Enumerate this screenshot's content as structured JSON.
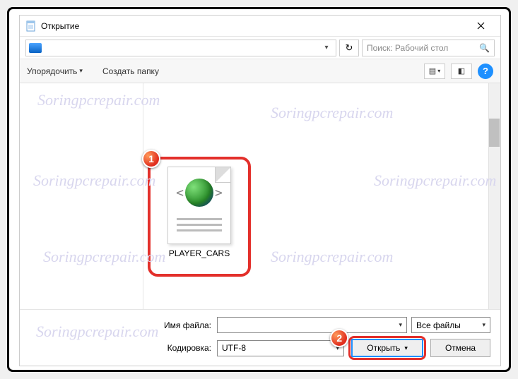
{
  "title": "Открытие",
  "search": {
    "placeholder": "Поиск: Рабочий стол"
  },
  "toolbar": {
    "organize": "Упорядочить",
    "new_folder": "Создать папку"
  },
  "file": {
    "name": "PLAYER_CARS"
  },
  "labels": {
    "filename": "Имя файла:",
    "encoding": "Кодировка:"
  },
  "filter": {
    "selected": "Все файлы"
  },
  "encoding": {
    "selected": "UTF-8"
  },
  "buttons": {
    "open": "Открыть",
    "cancel": "Отмена"
  },
  "markers": {
    "one": "1",
    "two": "2"
  },
  "watermark": "Soringpcrepair.com"
}
